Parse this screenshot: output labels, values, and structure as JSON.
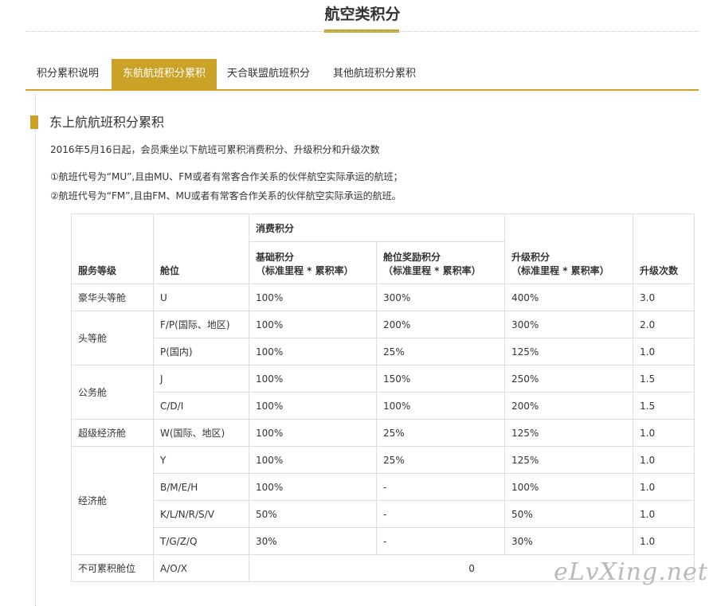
{
  "page_title": "航空类积分",
  "tabs": [
    {
      "label": "积分累积说明",
      "active": false
    },
    {
      "label": "东航航班积分累积",
      "active": true
    },
    {
      "label": "天合联盟航班积分",
      "active": false
    },
    {
      "label": "其他航班积分累积",
      "active": false
    }
  ],
  "section": {
    "title": "东上航航班积分累积",
    "intro": "2016年5月16日起，会员乘坐以下航班可累积消费积分、升级积分和升级次数",
    "rules": [
      "①航班代号为“MU”,且由MU、FM或者有常客合作关系的伙伴航空实际承运的航班；",
      "②航班代号为“FM”,且由FM、MU或者有常客合作关系的伙伴航空实际承运的航班。"
    ]
  },
  "table": {
    "headers": {
      "service_class": "服务等级",
      "cabin": "舱位",
      "consumption_group": "消费积分",
      "base_points": "基础积分",
      "base_points_formula": "（标准里程 * 累积率）",
      "cabin_bonus": "舱位奖励积分",
      "cabin_bonus_formula": "（标准里程 * 累积率）",
      "upgrade_points": "升级积分",
      "upgrade_points_formula": "（标准里程 * 累积率）",
      "upgrade_count": "升级次数"
    },
    "groups": [
      {
        "service": "豪华头等舱",
        "rows": [
          {
            "cabin": "U",
            "base": "100%",
            "bonus": "300%",
            "upgrade": "400%",
            "count": "3.0"
          }
        ]
      },
      {
        "service": "头等舱",
        "rows": [
          {
            "cabin": "F/P(国际、地区)",
            "base": "100%",
            "bonus": "200%",
            "upgrade": "300%",
            "count": "2.0"
          },
          {
            "cabin": "P(国内)",
            "base": "100%",
            "bonus": "25%",
            "upgrade": "125%",
            "count": "1.0"
          }
        ]
      },
      {
        "service": "公务舱",
        "rows": [
          {
            "cabin": "J",
            "base": "100%",
            "bonus": "150%",
            "upgrade": "250%",
            "count": "1.5"
          },
          {
            "cabin": "C/D/I",
            "base": "100%",
            "bonus": "100%",
            "upgrade": "200%",
            "count": "1.5"
          }
        ]
      },
      {
        "service": "超级经济舱",
        "rows": [
          {
            "cabin": "W(国际、地区)",
            "base": "100%",
            "bonus": "25%",
            "upgrade": "125%",
            "count": "1.0"
          }
        ]
      },
      {
        "service": "经济舱",
        "rows": [
          {
            "cabin": "Y",
            "base": "100%",
            "bonus": "25%",
            "upgrade": "125%",
            "count": "1.0"
          },
          {
            "cabin": "B/M/E/H",
            "base": "100%",
            "bonus": "-",
            "upgrade": "100%",
            "count": "1.0"
          },
          {
            "cabin": "K/L/N/R/S/V",
            "base": "50%",
            "bonus": "-",
            "upgrade": "50%",
            "count": "1.0"
          },
          {
            "cabin": "T/G/Z/Q",
            "base": "30%",
            "bonus": "-",
            "upgrade": "30%",
            "count": "1.0"
          }
        ]
      }
    ],
    "non_accrual": {
      "service": "不可累积舱位",
      "cabin": "A/O/X",
      "value": "0"
    }
  },
  "watermark": "eLvXing.net",
  "colors": {
    "accent": "#c9a227",
    "border": "#dedede",
    "text": "#333333"
  }
}
